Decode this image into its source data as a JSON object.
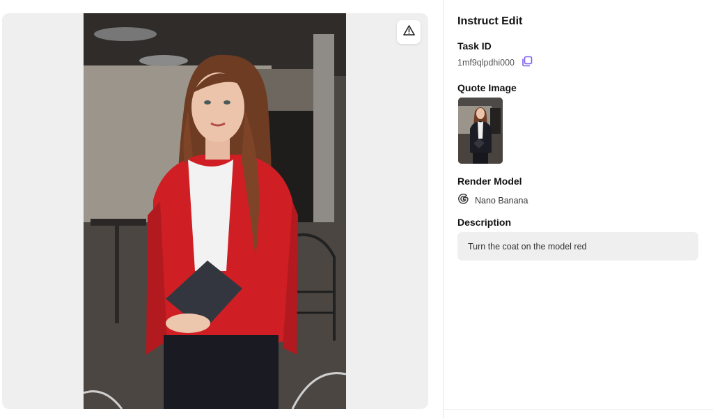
{
  "panel": {
    "title": "Instruct Edit",
    "task_id_label": "Task ID",
    "task_id": "1mf9qlpdhi000",
    "quote_image_label": "Quote Image",
    "render_model_label": "Render Model",
    "render_model": "Nano Banana",
    "description_label": "Description",
    "description": "Turn the coat on the model red"
  },
  "icons": {
    "report": "warning-triangle-icon",
    "copy": "copy-icon",
    "model": "google-g-icon"
  },
  "colors": {
    "accent": "#7b5cf0",
    "coat": "#d42424"
  }
}
